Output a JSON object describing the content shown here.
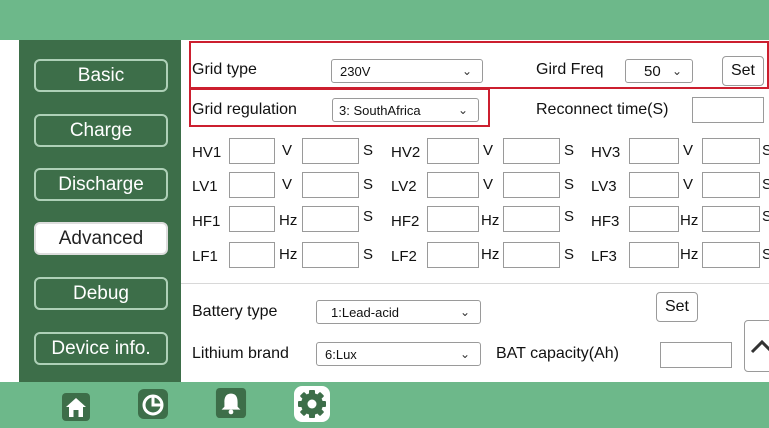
{
  "nav": {
    "items": [
      {
        "label": "Basic"
      },
      {
        "label": "Charge"
      },
      {
        "label": "Discharge"
      },
      {
        "label": "Advanced"
      },
      {
        "label": "Debug"
      },
      {
        "label": "Device info."
      }
    ],
    "active": "Advanced"
  },
  "grid": {
    "type_label": "Grid type",
    "type_value": "230V",
    "freq_label": "Gird Freq",
    "freq_value": "50",
    "set_label": "Set",
    "regulation_label": "Grid regulation",
    "regulation_value": "3: SouthAfrica",
    "reconnect_label": "Reconnect time(S)"
  },
  "protection": {
    "rows": [
      {
        "n1": "HV1",
        "u": "V",
        "s": "S",
        "n2": "HV2",
        "n3": "HV3"
      },
      {
        "n1": "LV1",
        "u": "V",
        "s": "S",
        "n2": "LV2",
        "n3": "LV3"
      },
      {
        "n1": "HF1",
        "u": "Hz",
        "s": "S",
        "n2": "HF2",
        "n3": "HF3"
      },
      {
        "n1": "LF1",
        "u": "Hz",
        "s": "S",
        "n2": "LF2",
        "n3": "LF3"
      }
    ]
  },
  "battery": {
    "type_label": "Battery type",
    "type_value": "1:Lead-acid",
    "set_label": "Set",
    "brand_label": "Lithium brand",
    "brand_value": "6:Lux",
    "capacity_label": "BAT capacity(Ah)"
  },
  "bottom_icons": [
    "home-icon",
    "pie-chart-icon",
    "bell-icon",
    "settings-gear-icon"
  ],
  "colors": {
    "header": "#6db88a",
    "sidebar": "#3d6e49",
    "highlight": "#cc1f2f"
  }
}
